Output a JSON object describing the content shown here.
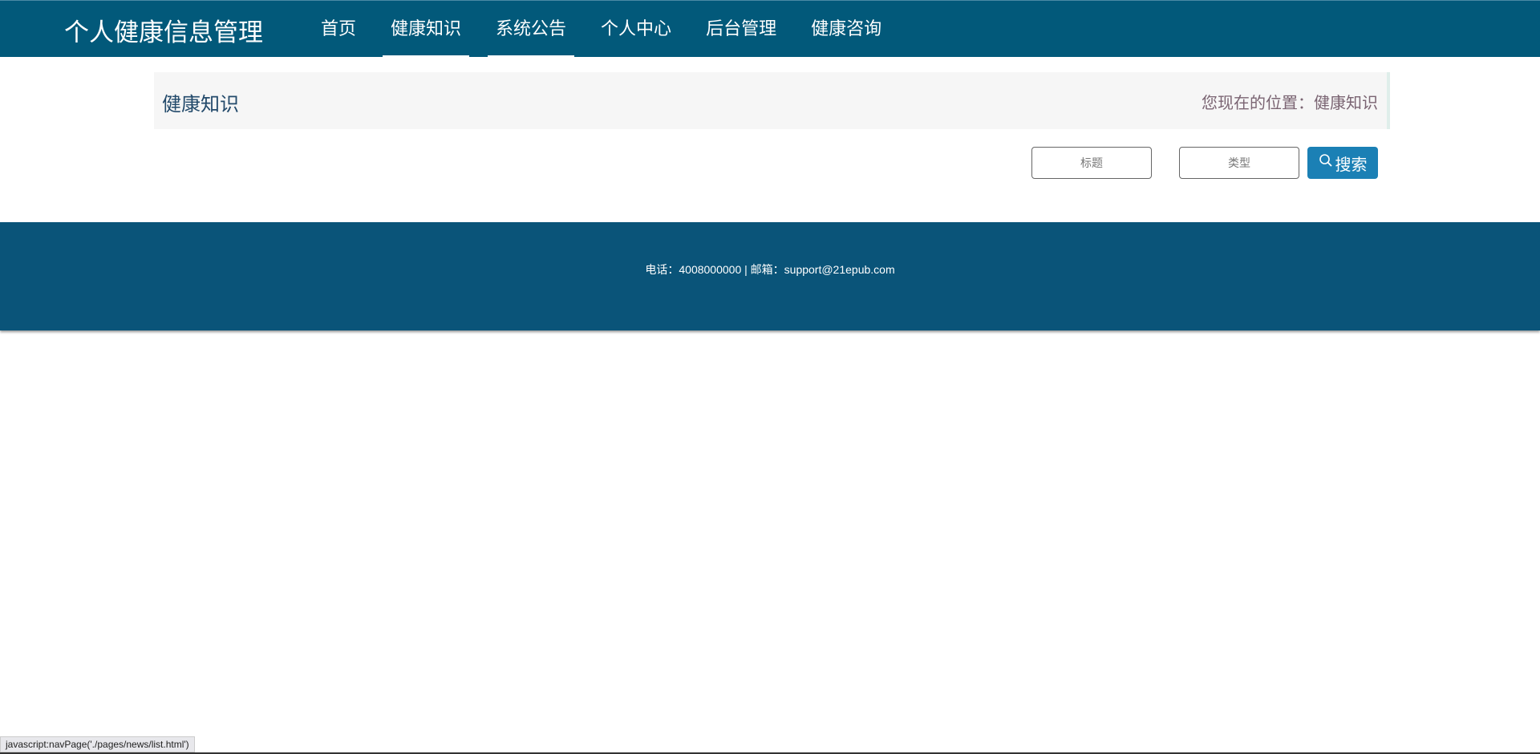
{
  "header": {
    "title": "个人健康信息管理",
    "nav": [
      {
        "label": "首页",
        "active": false
      },
      {
        "label": "健康知识",
        "active": true
      },
      {
        "label": "系统公告",
        "active": true
      },
      {
        "label": "个人中心",
        "active": false
      },
      {
        "label": "后台管理",
        "active": false
      },
      {
        "label": "健康咨询",
        "active": false
      }
    ]
  },
  "breadcrumb": {
    "title": "健康知识",
    "location": "您现在的位置：健康知识"
  },
  "search": {
    "title_placeholder": "标题",
    "type_placeholder": "类型",
    "button_label": "搜索"
  },
  "footer": {
    "contact": "电话：4008000000 | 邮箱：support@21epub.com"
  },
  "status_bar": {
    "url": "javascript:navPage('./pages/news/list.html')"
  },
  "colors": {
    "header": "#02597a",
    "footer": "#0a5479",
    "button": "#1b80b5"
  }
}
